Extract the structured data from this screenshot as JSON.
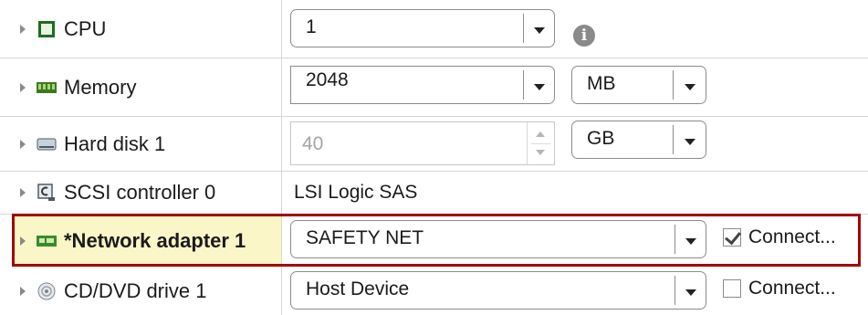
{
  "rows": [
    {
      "label": "CPU",
      "icon": "cpu-icon",
      "value": "1"
    },
    {
      "label": "Memory",
      "icon": "memory-icon",
      "value": "2048",
      "unit": "MB"
    },
    {
      "label": "Hard disk 1",
      "icon": "hard-disk-icon",
      "value": "40",
      "unit": "GB"
    },
    {
      "label": "SCSI controller 0",
      "icon": "scsi-controller-icon",
      "value": "LSI Logic SAS"
    },
    {
      "label": "*Network adapter 1",
      "icon": "network-adapter-icon",
      "value": "SAFETY NET",
      "connect_label": "Connect...",
      "connected": true
    },
    {
      "label": "CD/DVD drive 1",
      "icon": "cd-dvd-icon",
      "value": "Host Device",
      "connect_label": "Connect...",
      "connected": false
    }
  ],
  "colors": {
    "highlight_border": "#a30000",
    "highlight_fill": "#fbf6c7"
  }
}
